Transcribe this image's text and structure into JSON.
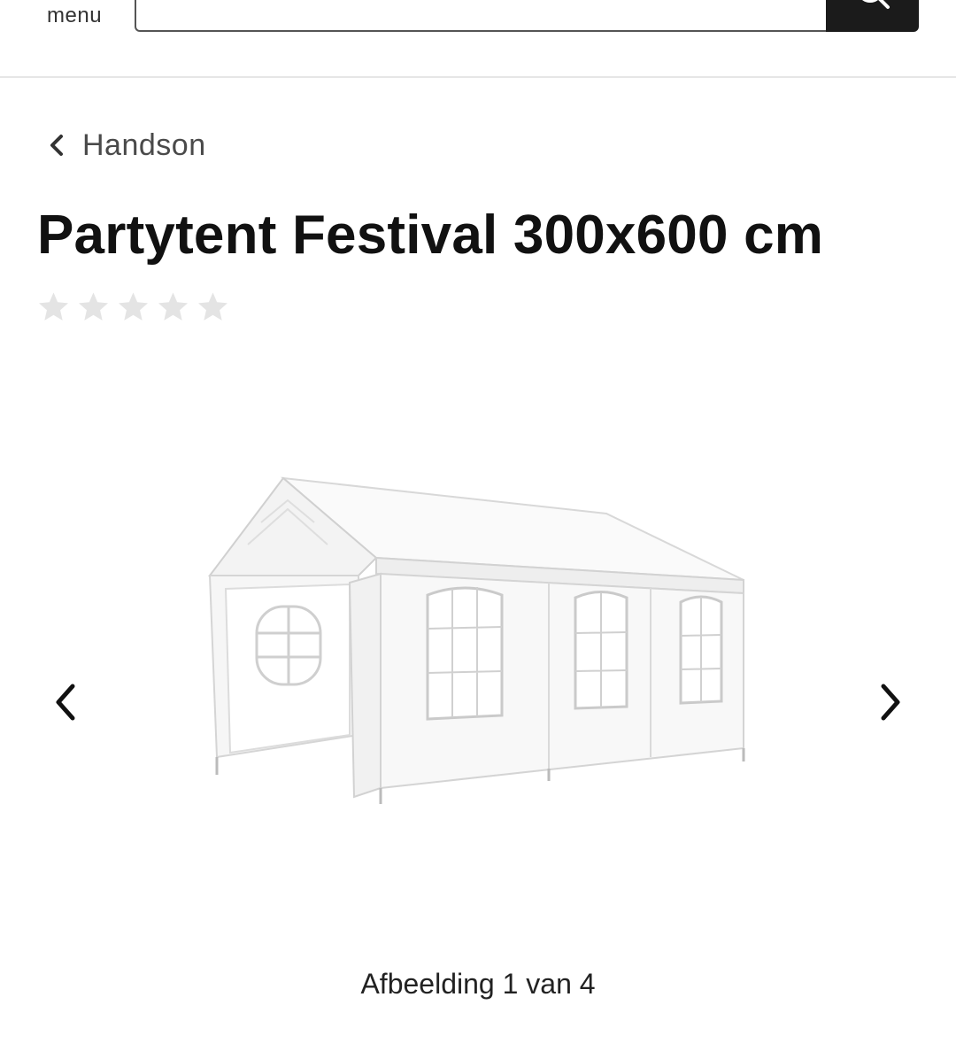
{
  "header": {
    "menu_label": "menu",
    "search": {
      "value": "",
      "placeholder": ""
    },
    "search_icon": "search-icon"
  },
  "breadcrumb": {
    "icon": "chevron-left-icon",
    "label": "Handson"
  },
  "product": {
    "title": "Partytent Festival 300x600 cm",
    "rating": {
      "value": 0,
      "max": 5,
      "star_color_empty": "#e4e4e4"
    }
  },
  "gallery": {
    "prev_icon": "chevron-left-icon",
    "next_icon": "chevron-right-icon",
    "image_alt": "Partytent Festival 300x600 cm",
    "counter": "Afbeelding 1 van 4"
  }
}
